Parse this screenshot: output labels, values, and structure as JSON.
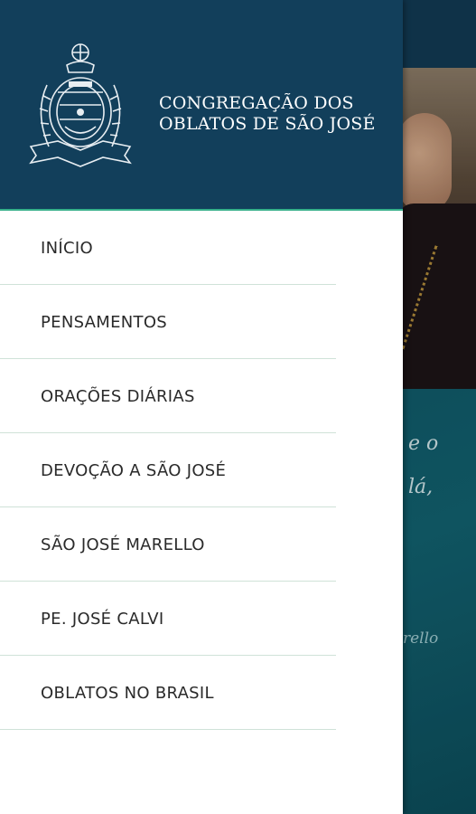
{
  "header": {
    "title_line1": "CONGREGAÇÃO DOS",
    "title_line2": "OBLATOS DE SÃO JOSÉ",
    "logo_icon": "oblates-crest-icon"
  },
  "menu": {
    "items": [
      {
        "label": "INÍCIO"
      },
      {
        "label": "PENSAMENTOS"
      },
      {
        "label": "ORAÇÕES DIÁRIAS"
      },
      {
        "label": "DEVOÇÃO A SÃO JOSÉ"
      },
      {
        "label": "SÃO JOSÉ MARELLO"
      },
      {
        "label": "PE. JOSÉ CALVI"
      },
      {
        "label": "OBLATOS NO BRASIL"
      }
    ]
  },
  "background": {
    "quote_fragment_1": "e o",
    "quote_fragment_2": "lá,",
    "quote_fragment_3": "rello"
  },
  "colors": {
    "header_bg": "#123f5b",
    "header_accent": "#36b08a",
    "divider": "#cfe2d8",
    "quote_bg": "#12606e"
  }
}
